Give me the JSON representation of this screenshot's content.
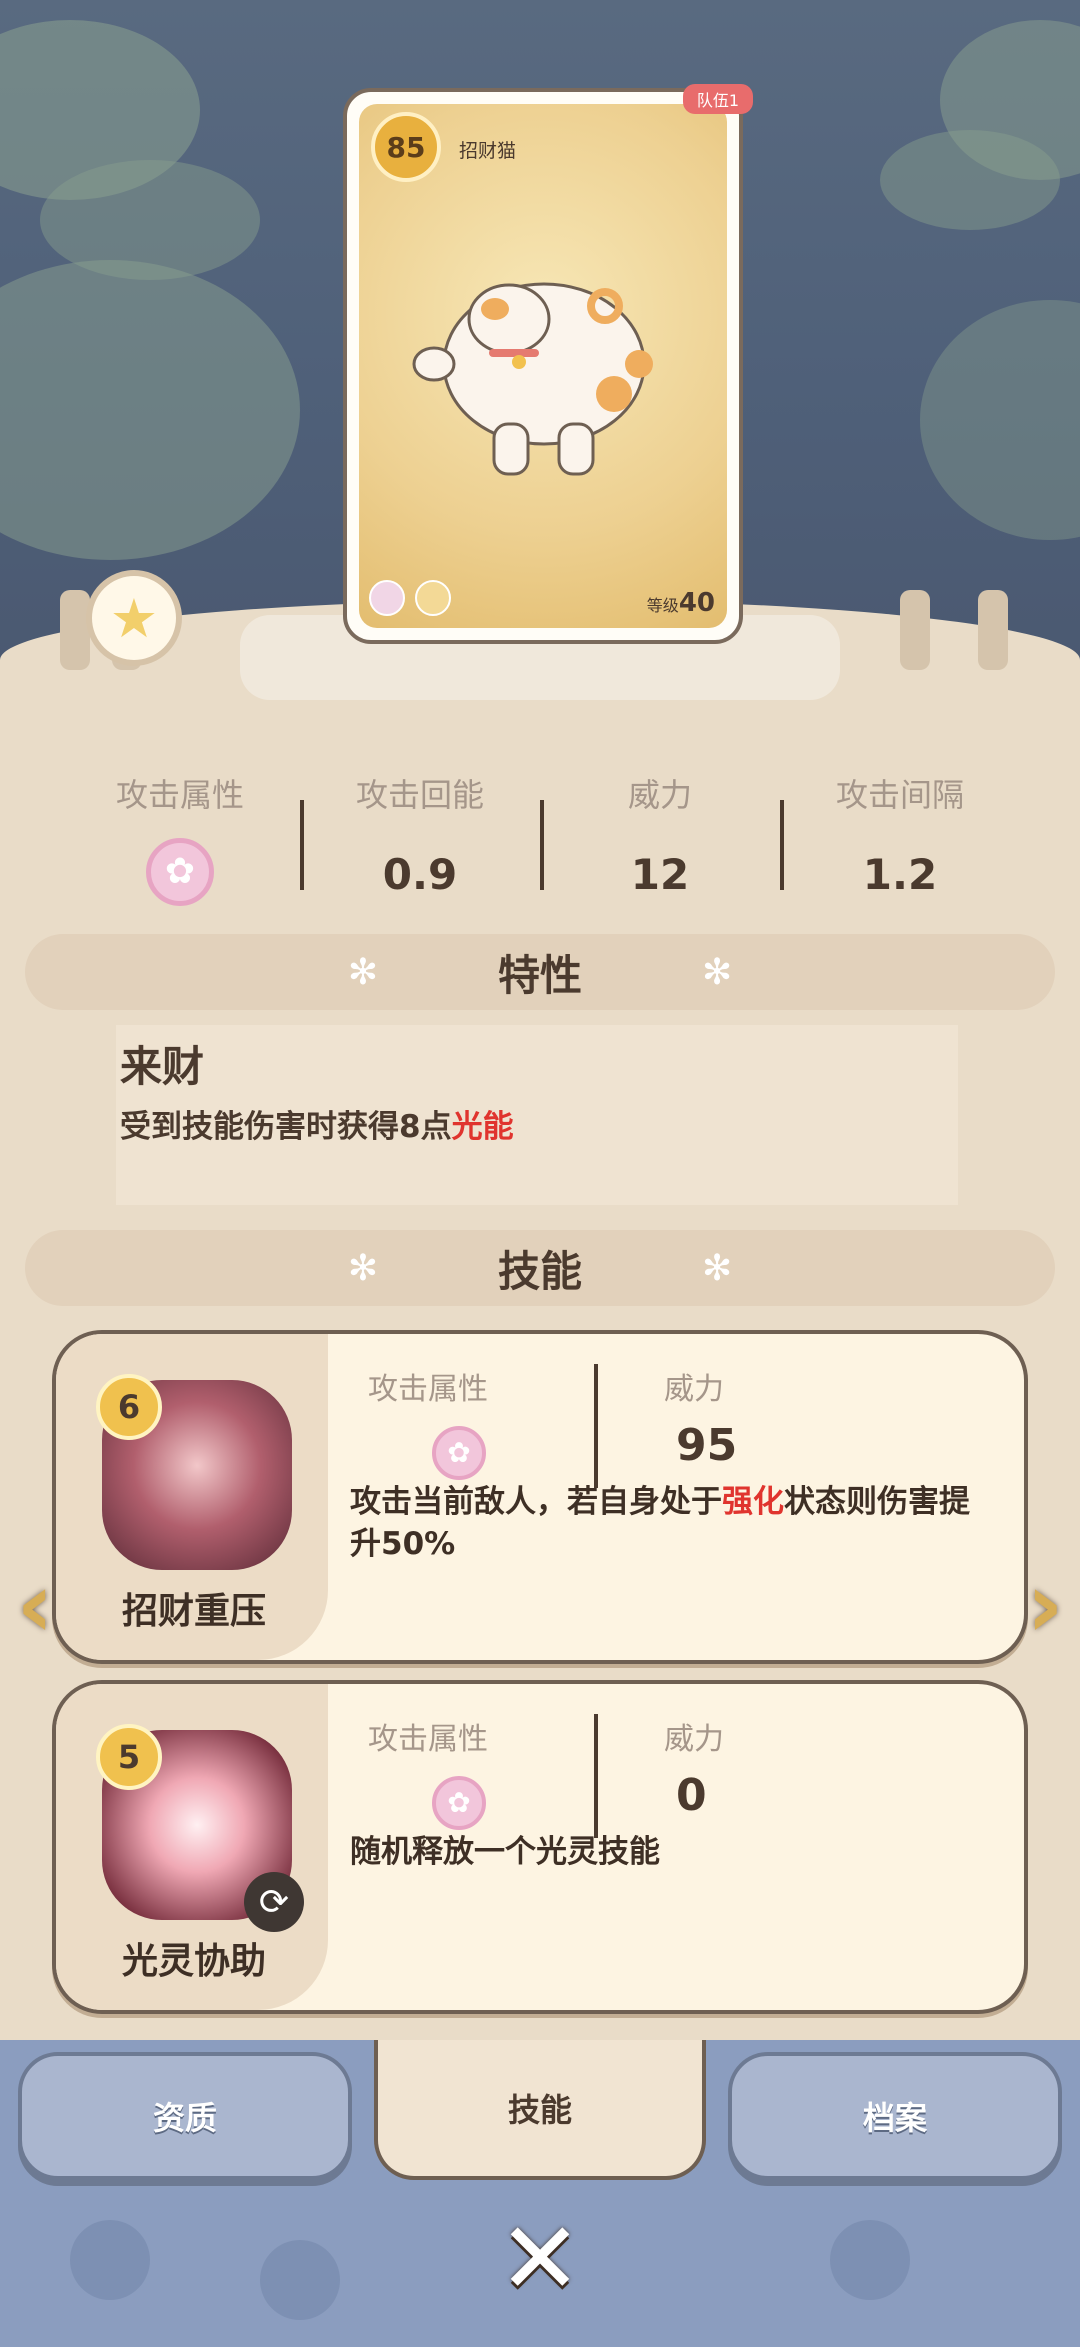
{
  "card": {
    "rank": "85",
    "name": "招财猫",
    "team_tag": "队伍1",
    "level_label": "等级",
    "level_value": "40"
  },
  "stats": [
    {
      "label": "攻击属性",
      "value": ""
    },
    {
      "label": "攻击回能",
      "value": "0.9"
    },
    {
      "label": "威力",
      "value": "12"
    },
    {
      "label": "攻击间隔",
      "value": "1.2"
    }
  ],
  "trait_section": {
    "title": "特性"
  },
  "trait": {
    "name": "来财",
    "desc_prefix": "受到技能伤害时获得8点",
    "desc_highlight": "光能"
  },
  "skill_section": {
    "title": "技能"
  },
  "skills": [
    {
      "cost": "6",
      "name": "招财重压",
      "attr_label": "攻击属性",
      "power_label": "威力",
      "power": "95",
      "desc_prefix": "攻击当前敌人，若自身处于",
      "desc_highlight": "强化",
      "desc_suffix": "状态则伤害提升50%"
    },
    {
      "cost": "5",
      "name": "光灵协助",
      "attr_label": "攻击属性",
      "power_label": "威力",
      "power": "0",
      "desc_prefix": "随机释放一个光灵技能",
      "desc_highlight": "",
      "desc_suffix": ""
    }
  ],
  "tabs": {
    "aptitude": "资质",
    "skills": "技能",
    "profile": "档案"
  },
  "icons": {
    "close": "close-icon",
    "star": "star-icon",
    "attr": "flower-icon",
    "prev": "chevron-left-icon",
    "next": "chevron-right-icon"
  },
  "colors": {
    "highlight": "#e0342e",
    "bottom_bar": "#8b9dbf",
    "panel": "#e9dcc8"
  }
}
